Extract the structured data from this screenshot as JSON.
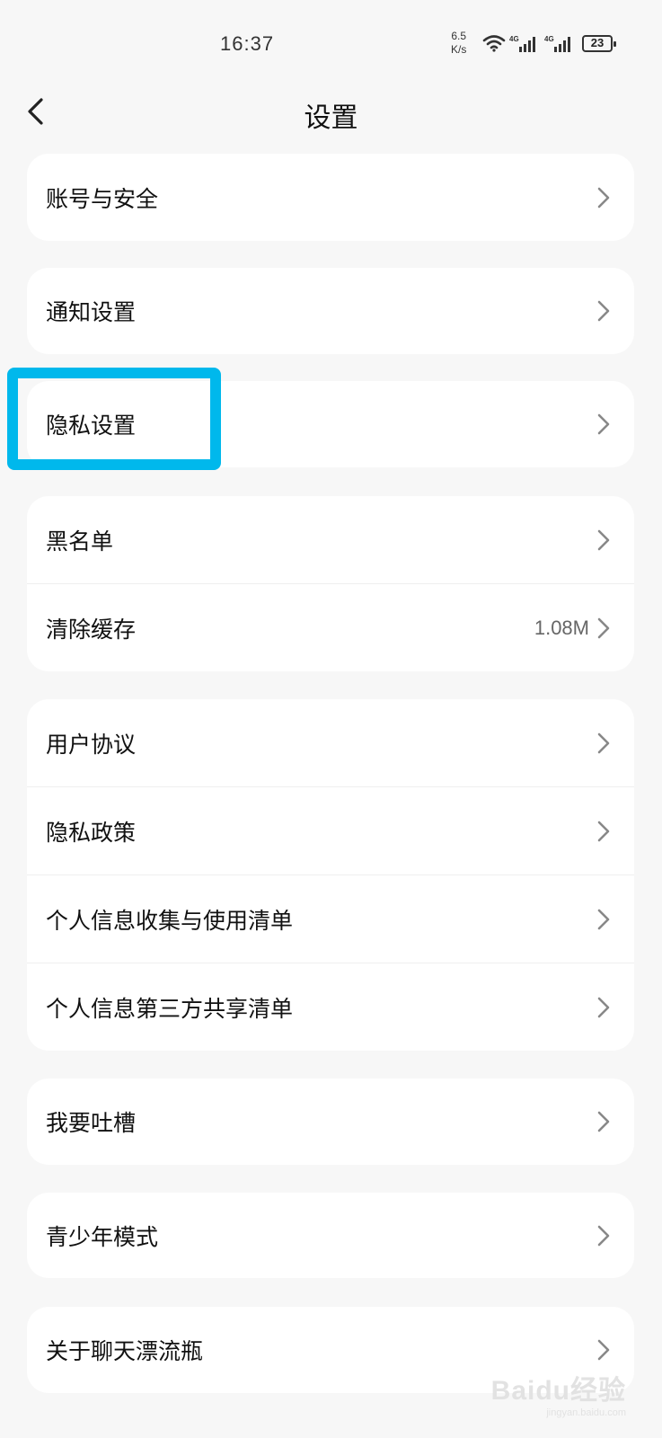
{
  "status_bar": {
    "time": "16:37",
    "net_speed_value": "6.5",
    "net_speed_unit": "K/s",
    "network_type": "4G",
    "battery_level": "23"
  },
  "header": {
    "title": "设置"
  },
  "cards": [
    [
      {
        "label": "账号与安全"
      }
    ],
    [
      {
        "label": "通知设置"
      }
    ],
    [
      {
        "label": "隐私设置"
      }
    ],
    [
      {
        "label": "黑名单"
      },
      {
        "label": "清除缓存",
        "value": "1.08M"
      }
    ],
    [
      {
        "label": "用户协议"
      },
      {
        "label": "隐私政策"
      },
      {
        "label": "个人信息收集与使用清单"
      },
      {
        "label": "个人信息第三方共享清单"
      }
    ],
    [
      {
        "label": "我要吐槽"
      }
    ],
    [
      {
        "label": "青少年模式"
      }
    ],
    [
      {
        "label": "关于聊天漂流瓶"
      }
    ]
  ],
  "watermark": {
    "brand": "Baidu经验",
    "url": "jingyan.baidu.com"
  },
  "colors": {
    "highlight": "#00b8ec",
    "background": "#f7f7f7",
    "card": "#ffffff"
  }
}
